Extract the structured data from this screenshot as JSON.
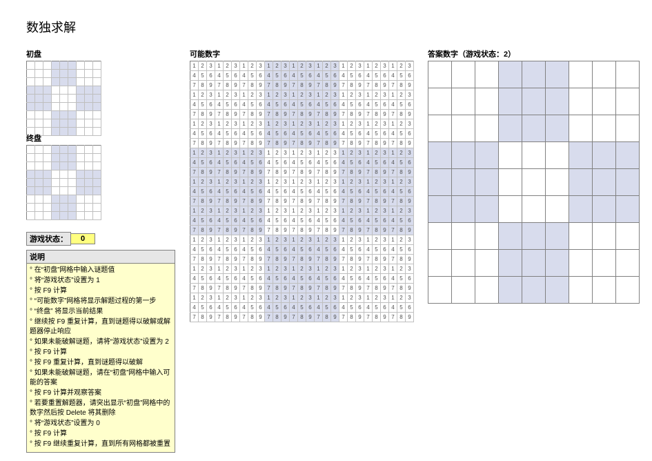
{
  "title": "数独求解",
  "labels": {
    "initial": "初盘",
    "final": "终盘",
    "possible": "可能数字",
    "answer": "答案数字（游戏状态：2）",
    "instructions_title": "说明"
  },
  "status": {
    "label": "游戏状态：",
    "value": "0"
  },
  "instructions": [
    "° 在“初盘”网格中输入谜题值",
    "° 将“游戏状态”设置为 1",
    "° 按 F9 计算",
    "° “可能数字”网格将显示解题过程的第一步",
    "° “终盘” 将显示当前结果",
    "° 继续按 F9 重复计算，直到谜题得以破解或解题器停止响应",
    "° 如果未能破解谜题，请将“游戏状态”设置为 2",
    "° 按 F9 计算",
    "° 按 F9 重复计算，直到谜题得以破解",
    "° 如果未能破解谜题，请在“初盘”网格中输入可能的答案",
    "° 按 F9 计算并观察答案",
    "° 若要重置解题器，请突出显示“初盘”网格中的数字然后按 Delete 将其删除",
    "° 将“游戏状态”设置为 0",
    "° 按 F9 计算",
    "° 按 F9 继续重复计算，直到所有网格都被重置"
  ],
  "chart_data": {
    "type": "table",
    "title": "Sudoku solver grids (empty state)",
    "initial_grid": [
      [
        "",
        "",
        "",
        "",
        "",
        "",
        "",
        "",
        ""
      ],
      [
        "",
        "",
        "",
        "",
        "",
        "",
        "",
        "",
        ""
      ],
      [
        "",
        "",
        "",
        "",
        "",
        "",
        "",
        "",
        ""
      ],
      [
        "",
        "",
        "",
        "",
        "",
        "",
        "",
        "",
        ""
      ],
      [
        "",
        "",
        "",
        "",
        "",
        "",
        "",
        "",
        ""
      ],
      [
        "",
        "",
        "",
        "",
        "",
        "",
        "",
        "",
        ""
      ],
      [
        "",
        "",
        "",
        "",
        "",
        "",
        "",
        "",
        ""
      ],
      [
        "",
        "",
        "",
        "",
        "",
        "",
        "",
        "",
        ""
      ],
      [
        "",
        "",
        "",
        "",
        "",
        "",
        "",
        "",
        ""
      ]
    ],
    "final_grid": [
      [
        "",
        "",
        "",
        "",
        "",
        "",
        "",
        "",
        ""
      ],
      [
        "",
        "",
        "",
        "",
        "",
        "",
        "",
        "",
        ""
      ],
      [
        "",
        "",
        "",
        "",
        "",
        "",
        "",
        "",
        ""
      ],
      [
        "",
        "",
        "",
        "",
        "",
        "",
        "",
        "",
        ""
      ],
      [
        "",
        "",
        "",
        "",
        "",
        "",
        "",
        "",
        ""
      ],
      [
        "",
        "",
        "",
        "",
        "",
        "",
        "",
        "",
        ""
      ],
      [
        "",
        "",
        "",
        "",
        "",
        "",
        "",
        "",
        ""
      ],
      [
        "",
        "",
        "",
        "",
        "",
        "",
        "",
        "",
        ""
      ],
      [
        "",
        "",
        "",
        "",
        "",
        "",
        "",
        "",
        ""
      ]
    ],
    "answer_grid": [
      [
        "",
        "",
        "",
        "",
        "",
        "",
        "",
        "",
        ""
      ],
      [
        "",
        "",
        "",
        "",
        "",
        "",
        "",
        "",
        ""
      ],
      [
        "",
        "",
        "",
        "",
        "",
        "",
        "",
        "",
        ""
      ],
      [
        "",
        "",
        "",
        "",
        "",
        "",
        "",
        "",
        ""
      ],
      [
        "",
        "",
        "",
        "",
        "",
        "",
        "",
        "",
        ""
      ],
      [
        "",
        "",
        "",
        "",
        "",
        "",
        "",
        "",
        ""
      ],
      [
        "",
        "",
        "",
        "",
        "",
        "",
        "",
        "",
        ""
      ],
      [
        "",
        "",
        "",
        "",
        "",
        "",
        "",
        "",
        ""
      ],
      [
        "",
        "",
        "",
        "",
        "",
        "",
        "",
        "",
        ""
      ]
    ],
    "possible_candidates_note": "Every cell currently shows all candidates 1–9 (default state).",
    "candidate_lines": [
      "1",
      "2",
      "3",
      "4",
      "5",
      "6",
      "7",
      "8",
      "9"
    ],
    "shaded_boxes_pattern": "checker-3x3-even",
    "game_state": 0
  }
}
